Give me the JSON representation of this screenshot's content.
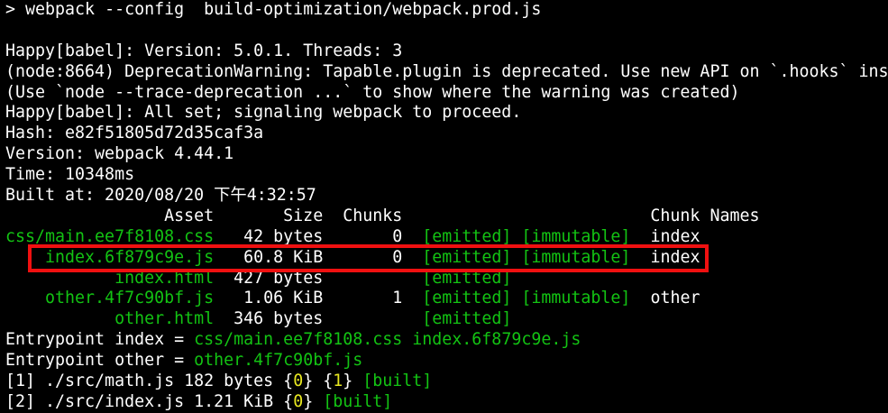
{
  "colors": {
    "background": "#000000",
    "text": "#ffffff",
    "green": "#13c313",
    "yellow": "#e8e820",
    "highlight_border": "#f01010"
  },
  "command": {
    "prompt": "> ",
    "text": "webpack --config  build-optimization/webpack.prod.js"
  },
  "log": {
    "happy_version": "Happy[babel]: Version: 5.0.1. Threads: 3",
    "deprecation": "(node:8664) DeprecationWarning: Tapable.plugin is deprecated. Use new API on `.hooks` ins",
    "trace_hint": "(Use `node --trace-deprecation ...` to show where the warning was created)",
    "happy_all_set": "Happy[babel]: All set; signaling webpack to proceed.",
    "hash": "Hash: e82f51805d72d35caf3a",
    "version": "Version: webpack 4.44.1",
    "time": "Time: 10348ms",
    "built_at": "Built at: 2020/08/20 下午4:32:57"
  },
  "assets_table": {
    "header": "                Asset       Size  Chunks                         Chunk Names",
    "rows": [
      {
        "pad": "",
        "name": "css/main.ee7f8108.css",
        "size_chunk": "   42 bytes       0  ",
        "emitted": "[emitted]",
        "gap": " ",
        "immutable": "[immutable]",
        "chunk_name": "  index"
      },
      {
        "pad": "    ",
        "name": "index.6f879c9e.js",
        "size_chunk": "   60.8 KiB       0  ",
        "emitted": "[emitted]",
        "gap": " ",
        "immutable": "[immutable]",
        "chunk_name": "  index"
      },
      {
        "pad": "           ",
        "name": "index.html",
        "size_chunk": "  427 bytes          ",
        "emitted": "[emitted]",
        "gap": "",
        "immutable": "",
        "chunk_name": ""
      },
      {
        "pad": "    ",
        "name": "other.4f7c90bf.js",
        "size_chunk": "   1.06 KiB       1  ",
        "emitted": "[emitted]",
        "gap": " ",
        "immutable": "[immutable]",
        "chunk_name": "  other"
      },
      {
        "pad": "           ",
        "name": "other.html",
        "size_chunk": "  346 bytes          ",
        "emitted": "[emitted]",
        "gap": "",
        "immutable": "",
        "chunk_name": ""
      }
    ]
  },
  "entrypoints": [
    {
      "prefix": "Entrypoint index = ",
      "files": "css/main.ee7f8108.css index.6f879c9e.js"
    },
    {
      "prefix": "Entrypoint other = ",
      "files": "other.4f7c90bf.js"
    }
  ],
  "modules": [
    {
      "prefix": "[1] ./src/math.js 182 bytes {",
      "id1": "0",
      "mid": "} {",
      "id2": "1",
      "end": "} ",
      "built": "[built]"
    },
    {
      "prefix": "[2] ./src/index.js 1.21 KiB {",
      "id1": "0",
      "mid": "",
      "id2": "",
      "end": "} ",
      "built": "[built]"
    }
  ]
}
